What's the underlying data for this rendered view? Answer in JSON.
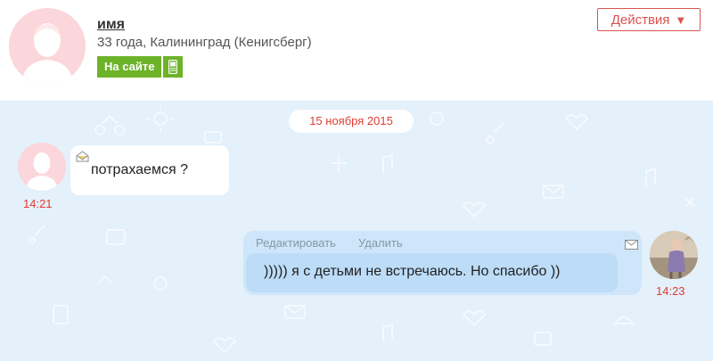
{
  "profile": {
    "name": "имя",
    "info": "33 года, Калининград (Кенигсберг)",
    "status_label": "На сайте",
    "status_icon": "mobile-phone-icon",
    "actions_label": "Действия",
    "actions_arrow": "▼"
  },
  "chat": {
    "date": "15 ноября 2015",
    "messages": [
      {
        "direction": "incoming",
        "text": "потрахаемся ?",
        "time": "14:21",
        "icon": "envelope-open-icon"
      },
      {
        "direction": "outgoing",
        "text": "))))) я с детьми не встречаюсь. Но спасибо ))",
        "time": "14:23",
        "edit_label": "Редактировать",
        "delete_label": "Удалить",
        "icon": "envelope-icon"
      }
    ]
  },
  "colors": {
    "accent_red": "#e03c31",
    "online_green": "#6db32a",
    "chat_bg": "#e4f0fa",
    "outgoing_bubble": "#cfe6fa"
  }
}
